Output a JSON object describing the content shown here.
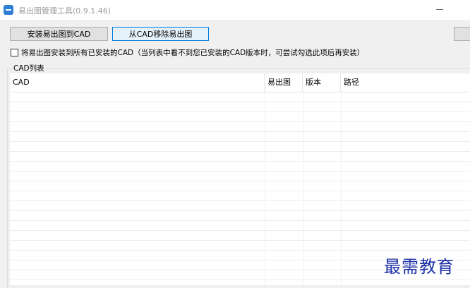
{
  "window": {
    "title": "易出图管理工具(0.9.1.46)",
    "app_icon": "app-icon"
  },
  "toolbar": {
    "install_label": "安装易出图到CAD",
    "remove_label": "从CAD移除易出图",
    "accent_color": "#0078d7"
  },
  "option": {
    "install_all_label": "将易出图安装到所有已安装的CAD（当列表中看不到您已安装的CAD版本时，可尝试勾选此项后再安装）",
    "checked": false
  },
  "cad_list": {
    "group_title": "CAD列表",
    "columns": [
      "CAD",
      "易出图",
      "版本",
      "路径"
    ],
    "rows": []
  },
  "watermark": {
    "text": "最需教育",
    "color": "#1c2fa8"
  }
}
